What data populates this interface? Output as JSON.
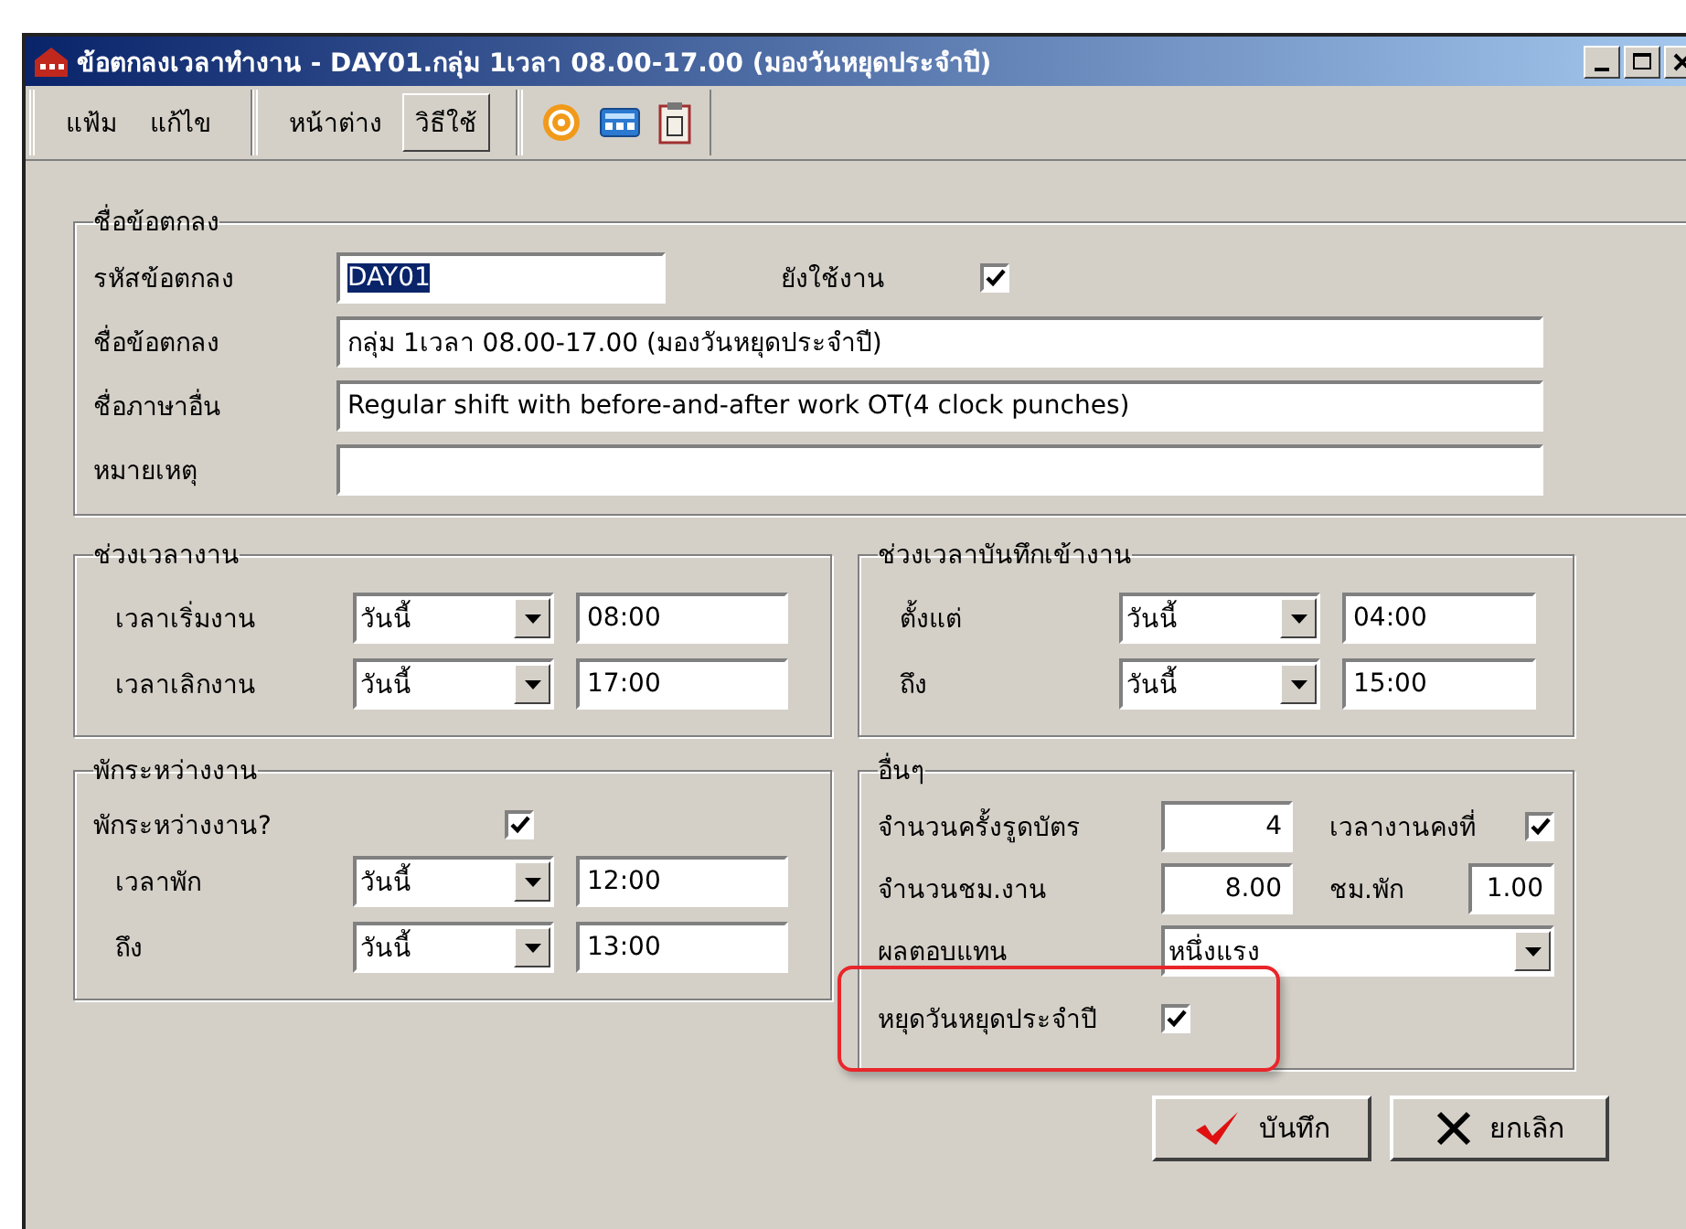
{
  "window": {
    "title": "ข้อตกลงเวลาทำงาน - DAY01.กลุ่ม 1เวลา 08.00-17.00 (มองวันหยุดประจำปี)"
  },
  "toolbar": {
    "groups": [
      [
        {
          "label": "แฟ้ม",
          "selected": false
        },
        {
          "label": "แก้ไข",
          "selected": false
        }
      ],
      [
        {
          "label": "หน้าต่าง",
          "selected": false
        },
        {
          "label": "วิธีใช้",
          "selected": true
        }
      ]
    ]
  },
  "agreement": {
    "title": "ชื่อข้อตกลง",
    "code": {
      "label": "รหัสข้อตกลง",
      "value": "DAY01",
      "text_selected": true
    },
    "active": {
      "label": "ยังใช้งาน",
      "checked": true
    },
    "fields": [
      {
        "label": "ชื่อข้อตกลง",
        "value": "กลุ่ม 1เวลา 08.00-17.00 (มองวันหยุดประจำปี)"
      },
      {
        "label": "ชื่อภาษาอื่น",
        "value": "Regular shift with before-and-after work OT(4 clock punches)"
      },
      {
        "label": "หมายเหตุ"
      }
    ]
  },
  "work_period": {
    "title": "ช่วงเวลางาน",
    "rows": [
      {
        "label": "เวลาเริ่มงาน",
        "day": "วันนี้",
        "time": "08:00"
      },
      {
        "label": "เวลาเลิกงาน",
        "day": "วันนี้",
        "time": "17:00"
      }
    ]
  },
  "clock_period": {
    "title": "ช่วงเวลาบันทึกเข้างาน",
    "rows": [
      {
        "label": "ตั้งแต่",
        "day": "วันนี้",
        "time": "04:00"
      },
      {
        "label": "ถึง",
        "day": "วันนี้",
        "time": "15:00"
      }
    ]
  },
  "break": {
    "title": "พักระหว่างงาน",
    "enabled": {
      "label": "พักระหว่างงาน?",
      "checked": true
    },
    "rows": [
      {
        "label": "เวลาพัก",
        "day": "วันนี้",
        "time": "12:00"
      },
      {
        "label": "ถึง",
        "day": "วันนี้",
        "time": "13:00"
      }
    ]
  },
  "other": {
    "title": "อื่นๆ",
    "punch_count": {
      "label": "จำนวนครั้งรูดบัตร",
      "value": "4"
    },
    "fixed_time": {
      "label": "เวลางานคงที่",
      "checked": true
    },
    "work_hours": {
      "label": "จำนวนชม.งาน",
      "value": "8.00"
    },
    "break_hours": {
      "label": "ชม.พัก",
      "value": "1.00"
    },
    "compensation": {
      "label": "ผลตอบแทน",
      "value": "หนึ่งแรง"
    },
    "annual_holiday": {
      "label": "หยุดวันหยุดประจำปี",
      "checked": true,
      "highlighted": true
    }
  },
  "buttons": [
    {
      "label": "บันทึก",
      "kind": "save"
    },
    {
      "label": "ยกเลิก",
      "kind": "cancel"
    }
  ]
}
